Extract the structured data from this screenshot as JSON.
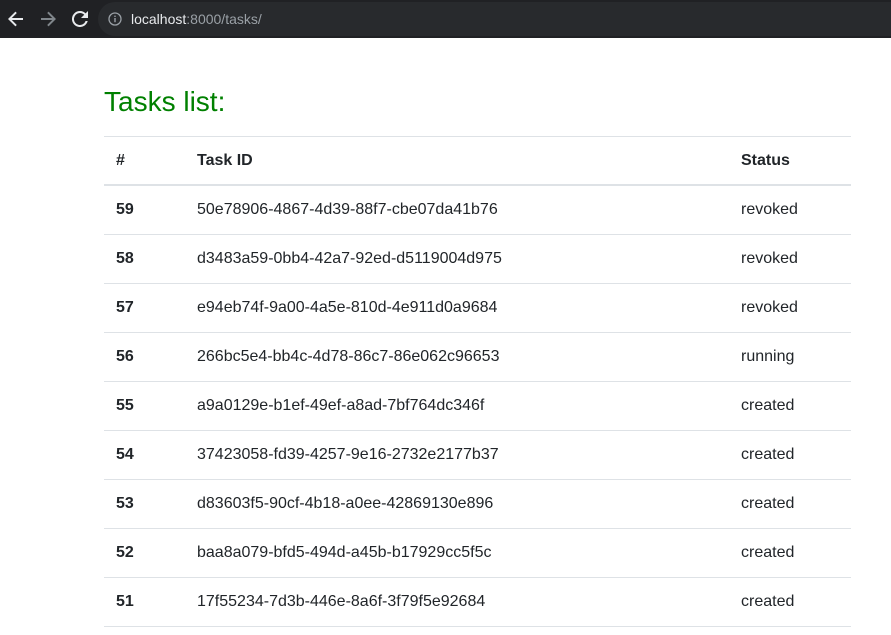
{
  "browser": {
    "url_host": "localhost",
    "url_rest": ":8000/tasks/",
    "icons": [
      "back-arrow-icon",
      "forward-arrow-icon",
      "reload-icon",
      "info-icon"
    ]
  },
  "page": {
    "title": "Tasks list:",
    "title_color": "#008000"
  },
  "table": {
    "headers": [
      "#",
      "Task ID",
      "Status"
    ],
    "rows": [
      {
        "num": "59",
        "task_id": "50e78906-4867-4d39-88f7-cbe07da41b76",
        "status": "revoked"
      },
      {
        "num": "58",
        "task_id": "d3483a59-0bb4-42a7-92ed-d5119004d975",
        "status": "revoked"
      },
      {
        "num": "57",
        "task_id": "e94eb74f-9a00-4a5e-810d-4e911d0a9684",
        "status": "revoked"
      },
      {
        "num": "56",
        "task_id": "266bc5e4-bb4c-4d78-86c7-86e062c96653",
        "status": "running"
      },
      {
        "num": "55",
        "task_id": "a9a0129e-b1ef-49ef-a8ad-7bf764dc346f",
        "status": "created"
      },
      {
        "num": "54",
        "task_id": "37423058-fd39-4257-9e16-2732e2177b37",
        "status": "created"
      },
      {
        "num": "53",
        "task_id": "d83603f5-90cf-4b18-a0ee-42869130e896",
        "status": "created"
      },
      {
        "num": "52",
        "task_id": "baa8a079-bfd5-494d-a45b-b17929cc5f5c",
        "status": "created"
      },
      {
        "num": "51",
        "task_id": "17f55234-7d3b-446e-8a6f-3f79f5e92684",
        "status": "created"
      }
    ]
  }
}
